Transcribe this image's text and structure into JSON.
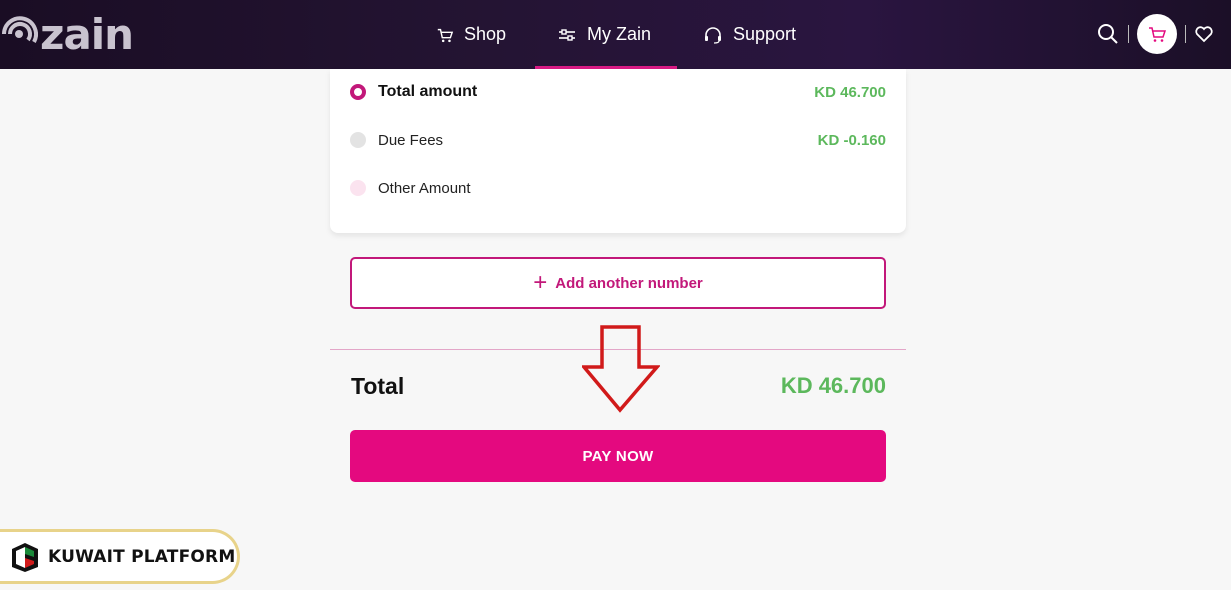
{
  "header": {
    "logo_text": "zain",
    "nav": [
      {
        "label": "Shop",
        "icon": "cart-icon"
      },
      {
        "label": "My Zain",
        "icon": "sliders-icon",
        "active": true
      },
      {
        "label": "Support",
        "icon": "headset-icon"
      }
    ]
  },
  "payment_options": [
    {
      "label": "Total amount",
      "amount": "KD 46.700",
      "selected": true
    },
    {
      "label": "Due Fees",
      "amount": "KD -0.160",
      "selected": false
    },
    {
      "label": "Other Amount",
      "amount": "",
      "selected": false
    }
  ],
  "add_number_label": "Add another number",
  "total": {
    "label": "Total",
    "value": "KD 46.700"
  },
  "pay_now_label": "PAY NOW",
  "watermark": {
    "text": "KUWAIT PLATFORM"
  },
  "colors": {
    "brand": "#e4097f",
    "accent_purple": "#c2187a",
    "amount_green": "#5cb85c",
    "header_bg": "#1f1030"
  }
}
